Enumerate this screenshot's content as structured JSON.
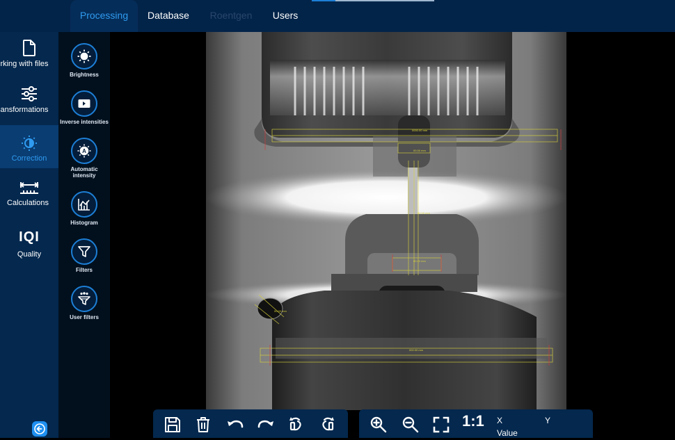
{
  "top_tabs": [
    {
      "label": "Processing",
      "state": "active"
    },
    {
      "label": "Database",
      "state": "normal"
    },
    {
      "label": "Roentgen",
      "state": "disabled"
    },
    {
      "label": "Users",
      "state": "normal"
    }
  ],
  "sidebar": {
    "items": [
      {
        "label": "Working with files",
        "visible_label": "rking with files",
        "icon": "file-icon"
      },
      {
        "label": "Transformations",
        "visible_label": "ansformations",
        "icon": "sliders-icon"
      },
      {
        "label": "Correction",
        "icon": "contrast-icon",
        "active": true
      },
      {
        "label": "Calculations",
        "icon": "ruler-icon"
      },
      {
        "label": "Quality",
        "icon_text": "IQI"
      }
    ],
    "collapse_icon": "arrow-left-icon"
  },
  "tools": [
    {
      "label": "Brightness",
      "icon": "sun-icon"
    },
    {
      "label": "Inverse intensities",
      "icon": "invert-icon"
    },
    {
      "label": "Automatic intensity",
      "icon": "auto-brightness-icon"
    },
    {
      "label": "Histogram",
      "icon": "histogram-icon"
    },
    {
      "label": "Filters",
      "icon": "funnel-icon"
    },
    {
      "label": "User filters",
      "icon": "user-funnel-icon"
    }
  ],
  "bottom_toolbar": {
    "buttons": [
      "save-icon",
      "trash-icon",
      "undo-icon",
      "redo-icon",
      "rotate-left-icon",
      "rotate-right-icon",
      "zoom-in-icon",
      "zoom-out-icon",
      "fit-screen-icon"
    ],
    "actual_size_label": "1:1",
    "x_label": "X",
    "y_label": "Y",
    "value_label": "Value"
  },
  "colors": {
    "accent": "#2f9bf0",
    "topbar": "#032449",
    "sidebar": "#04284e",
    "tool_ring": "#1d7fd6",
    "measure": "#d8d23a"
  }
}
